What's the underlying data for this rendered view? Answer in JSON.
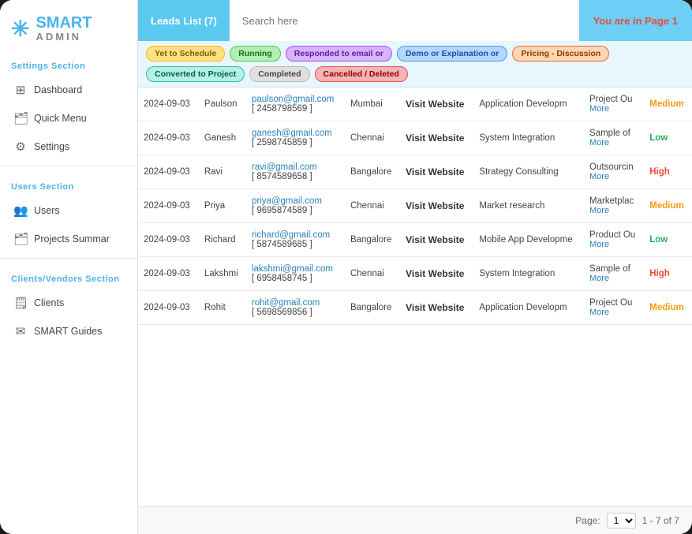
{
  "app": {
    "logo_smart": "SMART",
    "logo_admin": "ADMIN",
    "logo_icon": "✳"
  },
  "sidebar": {
    "settings_section_label": "Settings Section",
    "users_section_label": "Users Section",
    "clients_section_label": "Clients/Vendors Section",
    "items": [
      {
        "id": "dashboard",
        "label": "Dashboard",
        "icon": "⚙"
      },
      {
        "id": "quick-menu",
        "label": "Quick Menu",
        "icon": "🗂"
      },
      {
        "id": "settings",
        "label": "Settings",
        "icon": "⚙"
      },
      {
        "id": "users",
        "label": "Users",
        "icon": "👥"
      },
      {
        "id": "projects-summary",
        "label": "Projects Summar",
        "icon": "🗂"
      },
      {
        "id": "clients",
        "label": "Clients",
        "icon": "🗒"
      },
      {
        "id": "smart-guides",
        "label": "SMART Guides",
        "icon": "✉"
      }
    ]
  },
  "topbar": {
    "title": "Leads List (7)",
    "search_placeholder": "Search here",
    "page_info": "You are in Page 1"
  },
  "status_badges": [
    {
      "label": "Yet to Schedule",
      "class": "badge-yellow"
    },
    {
      "label": "Running",
      "class": "badge-green"
    },
    {
      "label": "Responded to email or",
      "class": "badge-purple"
    },
    {
      "label": "Demo or Explanation or",
      "class": "badge-blue"
    },
    {
      "label": "Pricing - Discussion",
      "class": "badge-orange"
    },
    {
      "label": "Converted to Project",
      "class": "badge-teal"
    },
    {
      "label": "Completed",
      "class": "badge-gray"
    },
    {
      "label": "Cancelled / Deleted",
      "class": "badge-red"
    }
  ],
  "table": {
    "rows": [
      {
        "date": "2024-09-03",
        "name": "Paulson",
        "email": "paulson@gmail.com",
        "phone": "[ 2458798569 ]",
        "city": "Mumbai",
        "action": "Visit Website",
        "service": "Application Developm",
        "product": "Project Ou",
        "product_more": "More",
        "priority": "Medium",
        "priority_class": "medium"
      },
      {
        "date": "2024-09-03",
        "name": "Ganesh",
        "email": "ganesh@gmail.com",
        "phone": "[ 2598745859 ]",
        "city": "Chennai",
        "action": "Visit Website",
        "service": "System Integration",
        "product": "Sample of",
        "product_more": "More",
        "priority": "Low",
        "priority_class": "low"
      },
      {
        "date": "2024-09-03",
        "name": "Ravi",
        "email": "ravi@gmail.com",
        "phone": "[ 8574589658 ]",
        "city": "Bangalore",
        "action": "Visit Website",
        "service": "Strategy Consulting",
        "product": "Outsourcin",
        "product_more": "More",
        "priority": "High",
        "priority_class": "high"
      },
      {
        "date": "2024-09-03",
        "name": "Priya",
        "email": "priya@gmail.com",
        "phone": "[ 9695874589 ]",
        "city": "Chennai",
        "action": "Visit Website",
        "service": "Market research",
        "product": "Marketplac",
        "product_more": "More",
        "priority": "Medium",
        "priority_class": "medium"
      },
      {
        "date": "2024-09-03",
        "name": "Richard",
        "email": "richard@gmail.com",
        "phone": "[ 5874589685 ]",
        "city": "Bangalore",
        "action": "Visit Website",
        "service": "Mobile App Developme",
        "product": "Product Ou",
        "product_more": "More",
        "priority": "Low",
        "priority_class": "low"
      },
      {
        "date": "2024-09-03",
        "name": "Lakshmi",
        "email": "lakshmi@gmail.com",
        "phone": "[ 6958458745 ]",
        "city": "Chennai",
        "action": "Visit Website",
        "service": "System Integration",
        "product": "Sample of",
        "product_more": "More",
        "priority": "High",
        "priority_class": "high"
      },
      {
        "date": "2024-09-03",
        "name": "Rohit",
        "email": "rohit@gmail.com",
        "phone": "[ 5698569856 ]",
        "city": "Bangalore",
        "action": "Visit Website",
        "service": "Application Developm",
        "product": "Project Ou",
        "product_more": "More",
        "priority": "Medium",
        "priority_class": "medium"
      }
    ]
  },
  "footer": {
    "page_label": "Page:",
    "page_value": "1",
    "page_range": "1 - 7 of 7"
  }
}
